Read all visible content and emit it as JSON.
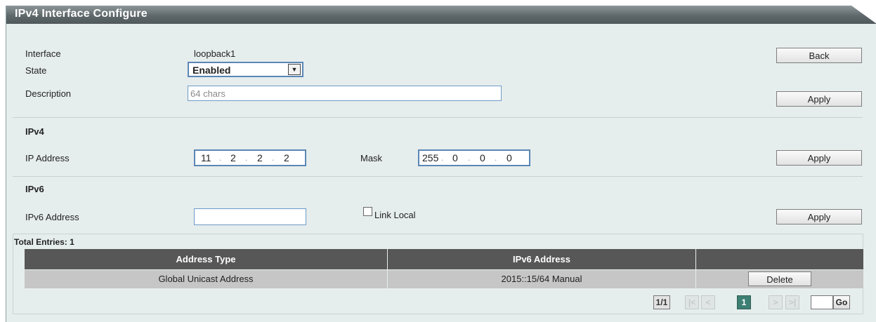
{
  "header": {
    "title": "IPv4 Interface Configure"
  },
  "form": {
    "interface_label": "Interface",
    "interface_value": "loopback1",
    "state_label": "State",
    "state_value": "Enabled",
    "description_label": "Description",
    "description_placeholder": "64 chars",
    "back_label": "Back",
    "apply_label": "Apply"
  },
  "ipv4": {
    "section_title": "IPv4",
    "ip_label": "IP Address",
    "ip_octets": [
      "11",
      "2",
      "2",
      "2"
    ],
    "mask_label": "Mask",
    "mask_octets": [
      "255",
      "0",
      "0",
      "0"
    ],
    "apply_label": "Apply"
  },
  "ipv6": {
    "section_title": "IPv6",
    "address_label": "IPv6 Address",
    "address_value": "",
    "link_local_label": "Link Local",
    "link_local_checked": false,
    "apply_label": "Apply"
  },
  "table": {
    "total_entries": "Total Entries: 1",
    "columns": [
      "Address Type",
      "IPv6 Address",
      ""
    ],
    "rows": [
      {
        "address_type": "Global Unicast Address",
        "ipv6_address": "2015::15/64 Manual",
        "action": "Delete"
      }
    ]
  },
  "pagination": {
    "page_count": "1/1",
    "first": "|<",
    "prev": "<",
    "current": "1",
    "next": ">",
    "last": ">|",
    "go_label": "Go"
  },
  "colors": {
    "title_bar": "#5f686b",
    "panel_bg": "#e6eded",
    "table_header": "#575757",
    "table_row": "#c6c6c6",
    "current_page": "#3e7f73"
  }
}
